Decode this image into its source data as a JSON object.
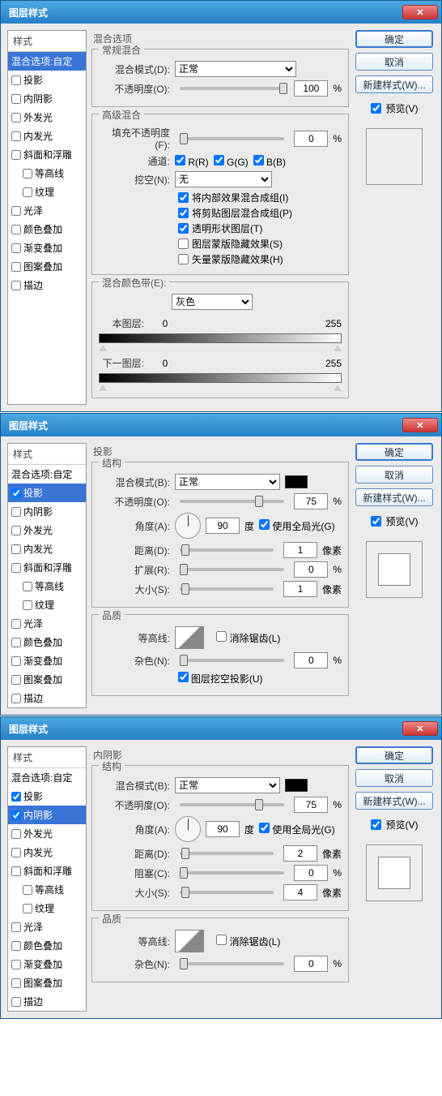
{
  "dialogs": [
    {
      "title": "图层样式",
      "selected": "混合选项:自定",
      "checked": [],
      "selIdx": null,
      "mid": {
        "sec": "混合选项",
        "g1": {
          "t": "常规混合",
          "mode_l": "混合模式(D):",
          "mode": "正常",
          "op_l": "不透明度(O):",
          "op": "100",
          "op_u": "%"
        },
        "g2": {
          "t": "高级混合",
          "fill_l": "填充不透明度(F):",
          "fill": "0",
          "fill_u": "%",
          "chan_l": "通道:",
          "r": "R(R)",
          "g": "G(G)",
          "b": "B(B)",
          "knock_l": "挖空(N):",
          "knock": "无",
          "c1": "将内部效果混合成组(I)",
          "c2": "将剪贴图层混合成组(P)",
          "c3": "透明形状图层(T)",
          "c4": "图层蒙版隐藏效果(S)",
          "c5": "矢量蒙版隐藏效果(H)"
        },
        "g3": {
          "t": "混合颜色带(E):",
          "sel": "灰色",
          "this_l": "本图层:",
          "next_l": "下一图层:",
          "v0": "0",
          "v1": "255"
        }
      }
    },
    {
      "title": "图层样式",
      "selected": "投影",
      "checked": [
        "投影"
      ],
      "selIdx": 1,
      "mid": {
        "sec": "投影",
        "g1": {
          "t": "结构",
          "mode_l": "混合模式(B):",
          "mode": "正常",
          "swatch": "#000",
          "op_l": "不透明度(O):",
          "op": "75",
          "op_u": "%",
          "ang_l": "角度(A):",
          "ang": "90",
          "ang_u": "度",
          "glob": "使用全局光(G)",
          "dist_l": "距离(D):",
          "dist": "1",
          "dist_u": "像素",
          "spr_l": "扩展(R):",
          "spr": "0",
          "spr_u": "%",
          "size_l": "大小(S):",
          "size": "1",
          "size_u": "像素"
        },
        "g2": {
          "t": "品质",
          "cont_l": "等高线:",
          "anti": "消除锯齿(L)",
          "noise_l": "杂色(N):",
          "noise": "0",
          "noise_u": "%",
          "knock": "图层挖空投影(U)"
        }
      }
    },
    {
      "title": "图层样式",
      "selected": "内阴影",
      "checked": [
        "投影",
        "内阴影"
      ],
      "selIdx": 2,
      "mid": {
        "sec": "内阴影",
        "g1": {
          "t": "结构",
          "mode_l": "混合模式(B):",
          "mode": "正常",
          "swatch": "#000",
          "op_l": "不透明度(O):",
          "op": "75",
          "op_u": "%",
          "ang_l": "角度(A):",
          "ang": "90",
          "ang_u": "度",
          "glob": "使用全局光(G)",
          "dist_l": "距离(D):",
          "dist": "2",
          "dist_u": "像素",
          "spr_l": "阻塞(C):",
          "spr": "0",
          "spr_u": "%",
          "size_l": "大小(S):",
          "size": "4",
          "size_u": "像素"
        },
        "g2": {
          "t": "品质",
          "cont_l": "等高线:",
          "anti": "消除锯齿(L)",
          "noise_l": "杂色(N):",
          "noise": "0",
          "noise_u": "%"
        }
      }
    }
  ],
  "styles_header": "样式",
  "style_items": [
    {
      "label": "混合选项:自定",
      "cb": false,
      "nochk": true
    },
    {
      "label": "投影",
      "cb": true
    },
    {
      "label": "内阴影",
      "cb": true
    },
    {
      "label": "外发光",
      "cb": true
    },
    {
      "label": "内发光",
      "cb": true
    },
    {
      "label": "斜面和浮雕",
      "cb": true
    },
    {
      "label": "等高线",
      "cb": true,
      "indent": true
    },
    {
      "label": "纹理",
      "cb": true,
      "indent": true
    },
    {
      "label": "光泽",
      "cb": true
    },
    {
      "label": "颜色叠加",
      "cb": true
    },
    {
      "label": "渐变叠加",
      "cb": true
    },
    {
      "label": "图案叠加",
      "cb": true
    },
    {
      "label": "描边",
      "cb": true
    }
  ],
  "buttons": {
    "ok": "确定",
    "cancel": "取消",
    "new": "新建样式(W)...",
    "preview": "预览(V)"
  }
}
